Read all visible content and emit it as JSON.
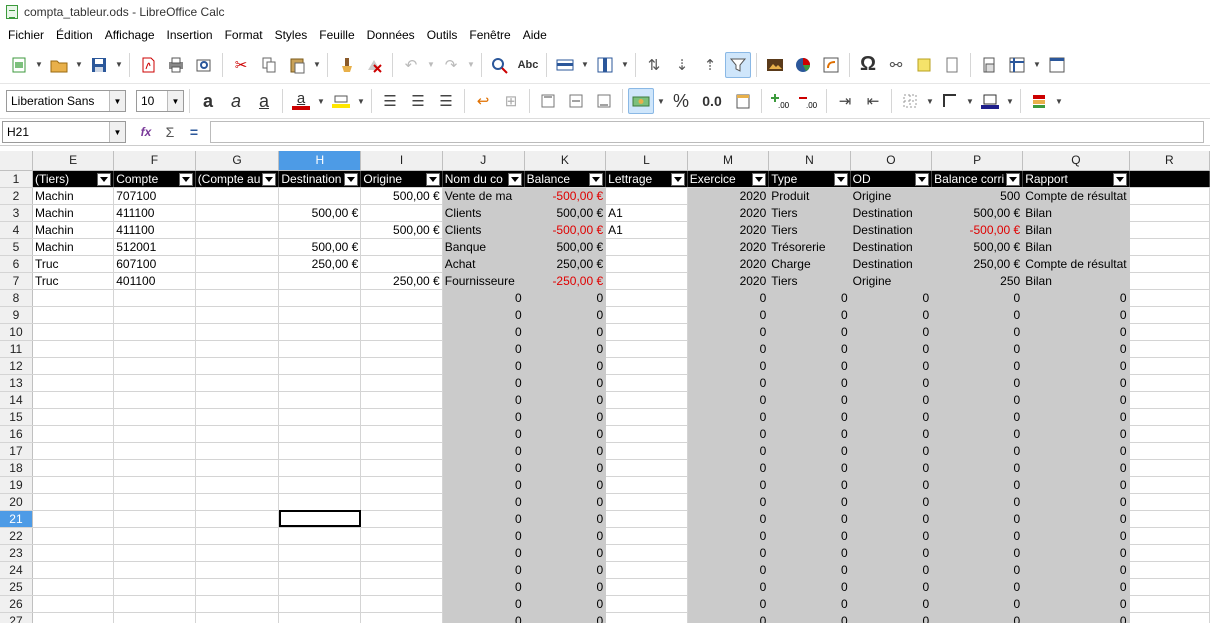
{
  "window": {
    "title": "compta_tableur.ods - LibreOffice Calc"
  },
  "menu": [
    "Fichier",
    "Édition",
    "Affichage",
    "Insertion",
    "Format",
    "Styles",
    "Feuille",
    "Données",
    "Outils",
    "Fenêtre",
    "Aide"
  ],
  "format": {
    "font_name": "Liberation Sans",
    "font_size": "10",
    "percent": "%",
    "decimal": "0.0"
  },
  "formula": {
    "cell_ref": "H21",
    "value": ""
  },
  "columns": [
    "E",
    "F",
    "G",
    "H",
    "I",
    "J",
    "K",
    "L",
    "M",
    "N",
    "O",
    "P",
    "Q",
    "R"
  ],
  "selected_column": "H",
  "selected_row": "21",
  "header_row": [
    "(Tiers)",
    "Compte",
    "(Compte au",
    "Destination",
    "Origine",
    "Nom du co",
    "Balance",
    "Lettrage",
    "Exercice",
    "Type",
    "OD",
    "Balance corri",
    "Rapport",
    ""
  ],
  "data_rows": [
    [
      "Machin",
      "707100",
      "",
      "",
      "500,00 €",
      "Vente de ma",
      "-500,00 €",
      "",
      "2020",
      "Produit",
      "Origine",
      "500",
      "Compte de résultat",
      ""
    ],
    [
      "Machin",
      "411100",
      "",
      "500,00 €",
      "",
      "Clients",
      "500,00 €",
      "A1",
      "2020",
      "Tiers",
      "Destination",
      "500,00 €",
      "Bilan",
      ""
    ],
    [
      "Machin",
      "411100",
      "",
      "",
      "500,00 €",
      "Clients",
      "-500,00 €",
      "A1",
      "2020",
      "Tiers",
      "Destination",
      "-500,00 €",
      "Bilan",
      ""
    ],
    [
      "Machin",
      "512001",
      "",
      "500,00 €",
      "",
      "Banque",
      "500,00 €",
      "",
      "2020",
      "Trésorerie",
      "Destination",
      "500,00 €",
      "Bilan",
      ""
    ],
    [
      "Truc",
      "607100",
      "",
      "250,00 €",
      "",
      "Achat",
      "250,00 €",
      "",
      "2020",
      "Charge",
      "Destination",
      "250,00 €",
      "Compte de résultat",
      ""
    ],
    [
      "Truc",
      "401100",
      "",
      "",
      "250,00 €",
      "Fournisseure",
      "-250,00 €",
      "",
      "2020",
      "Tiers",
      "Origine",
      "250",
      "Bilan",
      ""
    ]
  ],
  "zero_value": "0",
  "row_numbers": [
    "1",
    "2",
    "3",
    "4",
    "5",
    "6",
    "7",
    "8",
    "9",
    "10",
    "11",
    "12",
    "13",
    "14",
    "15",
    "16",
    "17",
    "18",
    "19",
    "20",
    "21",
    "22",
    "23",
    "24",
    "25",
    "26",
    "27"
  ],
  "colors": {
    "selection": "#4d9be6",
    "header_bg": "#000000",
    "gray_fill": "#cbcbcb",
    "negative": "#e00000"
  }
}
